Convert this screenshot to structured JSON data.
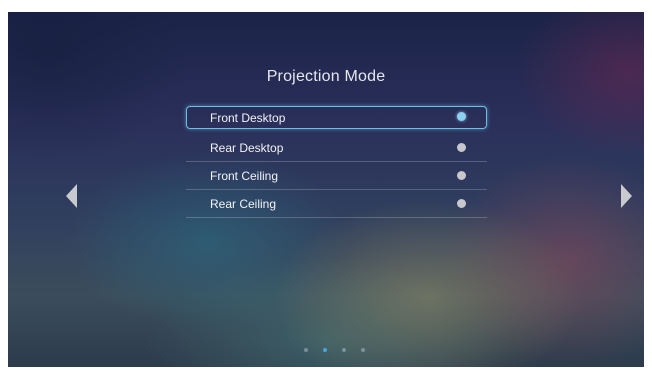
{
  "title": "Projection Mode",
  "options": [
    {
      "label": "Front Desktop",
      "selected": true
    },
    {
      "label": "Rear Desktop",
      "selected": false
    },
    {
      "label": "Front Ceiling",
      "selected": false
    },
    {
      "label": "Rear Ceiling",
      "selected": false
    }
  ],
  "navigation": {
    "left_icon": "triangle-left-icon",
    "right_icon": "triangle-right-icon"
  },
  "pager": {
    "count": 4,
    "active_index": 1
  },
  "colors": {
    "selection_border": "#6cc0e4",
    "selected_radio": "#8fcfef",
    "unselected_radio": "#c8c8cc",
    "active_dot": "#4aa6d8"
  }
}
